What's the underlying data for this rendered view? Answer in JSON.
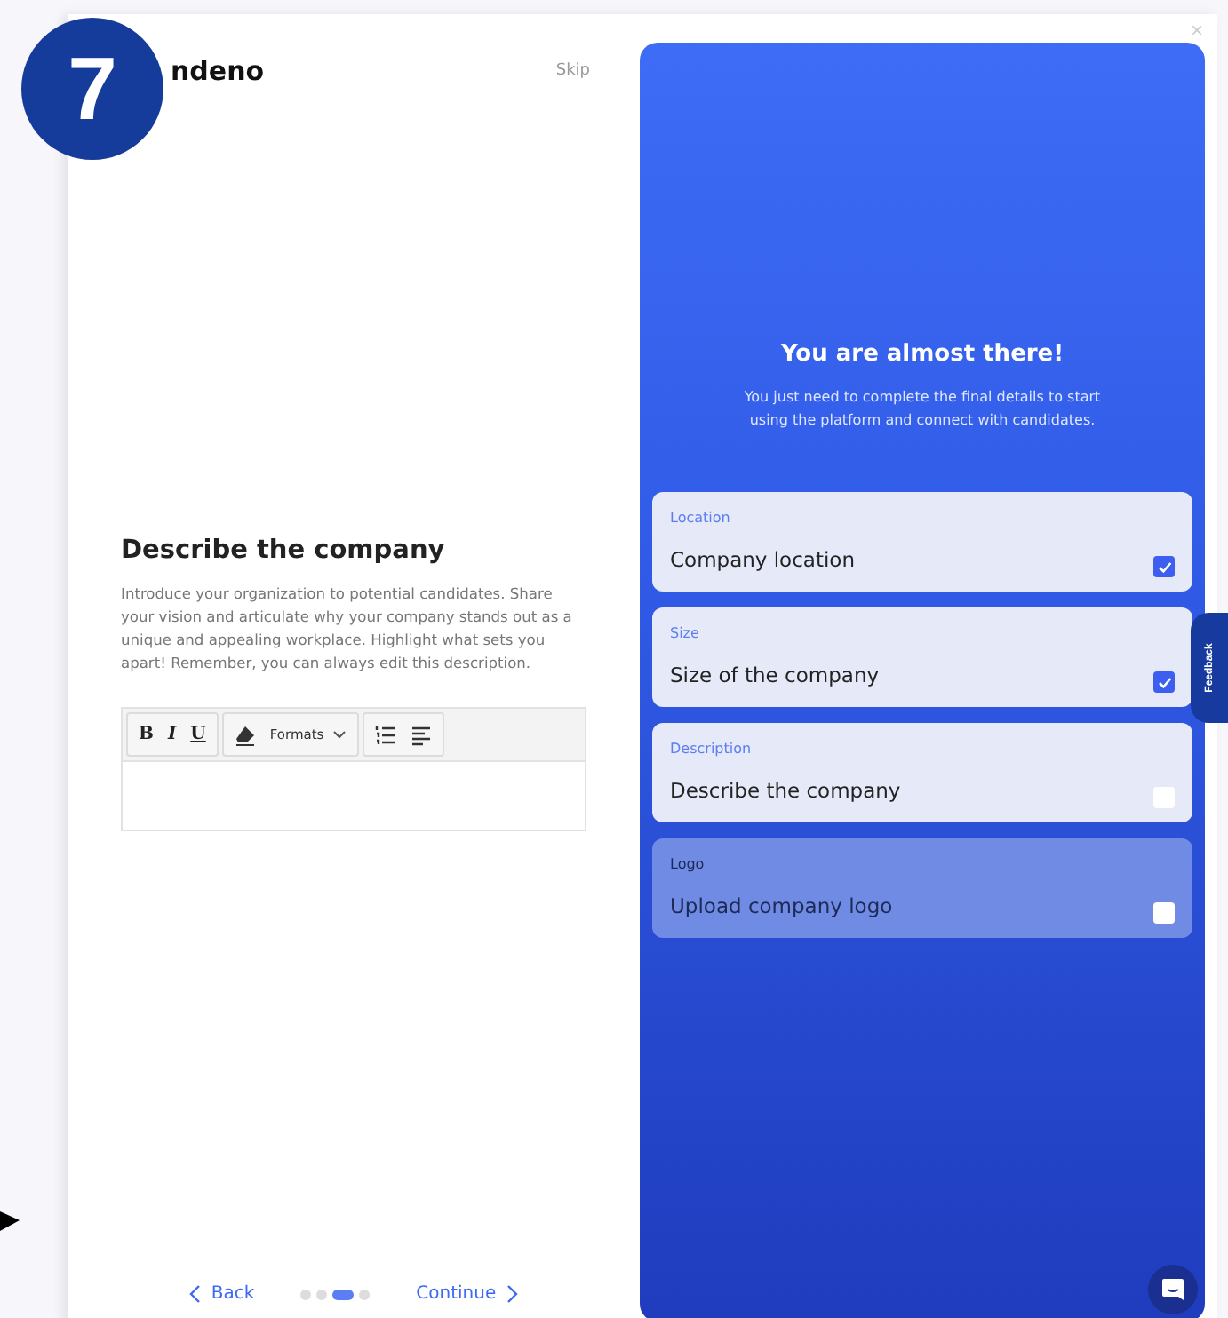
{
  "step_badge": "7",
  "logo": "ndeno",
  "skip": "Skip",
  "close": "×",
  "form": {
    "title": "Describe the company",
    "intro": "Introduce your organization to potential candidates. Share your vision and articulate why your company stands out as a unique and appealing workplace. Highlight what sets you apart! Remember, you can always edit this description.",
    "toolbar": [
      {
        "kind": "bold",
        "label": "B"
      },
      {
        "kind": "italic",
        "label": "I"
      },
      {
        "kind": "underline",
        "label": "U"
      },
      {
        "kind": "separator"
      },
      {
        "kind": "eraser"
      },
      {
        "kind": "dropdown",
        "label": "Formats"
      },
      {
        "kind": "separator"
      },
      {
        "kind": "numbered-list"
      },
      {
        "kind": "align"
      }
    ]
  },
  "nav": {
    "back": "Back",
    "continue": "Continue",
    "steps": [
      {
        "selected": false
      },
      {
        "selected": false
      },
      {
        "selected": true
      },
      {
        "selected": false
      }
    ]
  },
  "panel": {
    "title": "You are almost there!",
    "subtitle": "You just need to complete the final details to start using the platform and connect with candidates.",
    "items": [
      {
        "label": "Location",
        "value": "Company location",
        "checked": true,
        "selected": false
      },
      {
        "label": "Size",
        "value": "Size of the company",
        "checked": true,
        "selected": false
      },
      {
        "label": "Description",
        "value": "Describe the company",
        "checked": false,
        "selected": false
      },
      {
        "label": "Logo",
        "value": "Upload company logo",
        "checked": false,
        "selected": true
      }
    ]
  },
  "feedback_tab": "Feedback"
}
